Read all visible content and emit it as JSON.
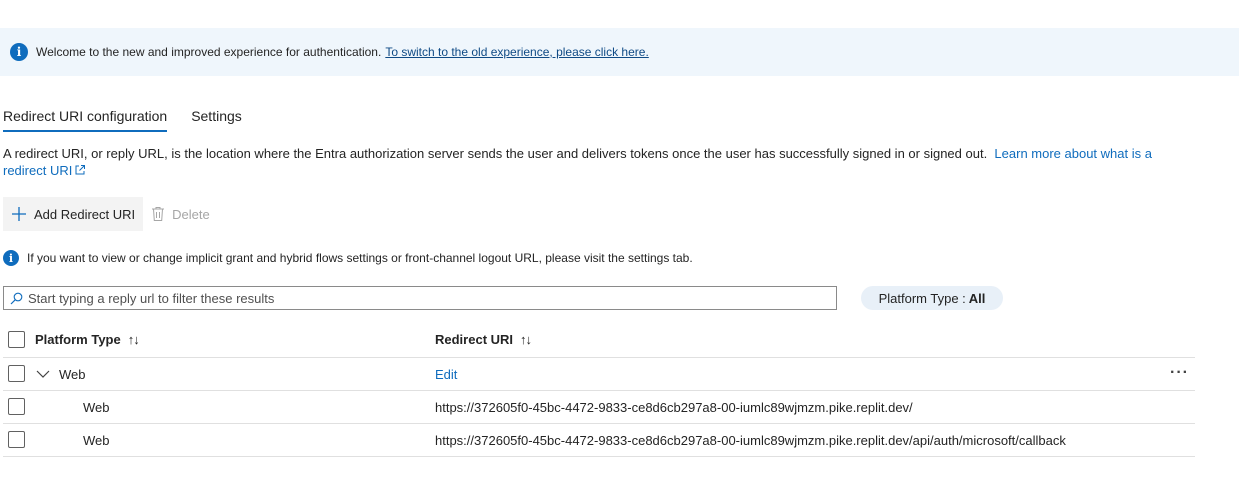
{
  "banner": {
    "icon": "info-icon",
    "text": "Welcome to the new and improved experience for authentication.",
    "link": "To switch to the old experience, please click here."
  },
  "tabs": [
    {
      "label": "Redirect URI configuration",
      "active": true
    },
    {
      "label": "Settings",
      "active": false
    }
  ],
  "description": {
    "text": "A redirect URI, or reply URL, is the location where the Entra authorization server sends the user and delivers tokens once the user has successfully signed in or signed out.",
    "link": "Learn more about what is a redirect URI"
  },
  "toolbar": {
    "add_label": "Add Redirect URI",
    "delete_label": "Delete"
  },
  "note": "If you want to view or change implicit grant and hybrid flows settings or front-channel logout URL, please visit the settings tab.",
  "filter": {
    "placeholder": "Start typing a reply url to filter these results"
  },
  "platform_filter": {
    "label": "Platform Type :",
    "value": "All"
  },
  "table": {
    "columns": [
      "Platform Type",
      "Redirect URI"
    ],
    "sort_icon": "↑↓",
    "group": {
      "name": "Web",
      "action": "Edit",
      "more": "···"
    },
    "rows": [
      {
        "platform": "Web",
        "uri": "https://372605f0-45bc-4472-9833-ce8d6cb297a8-00-iumlc89wjmzm.pike.replit.dev/"
      },
      {
        "platform": "Web",
        "uri": "https://372605f0-45bc-4472-9833-ce8d6cb297a8-00-iumlc89wjmzm.pike.replit.dev/api/auth/microsoft/callback"
      }
    ]
  },
  "colors": {
    "accent": "#0f6cbd",
    "banner_bg": "#eff6fc",
    "pill_bg": "#e8f0f8"
  }
}
